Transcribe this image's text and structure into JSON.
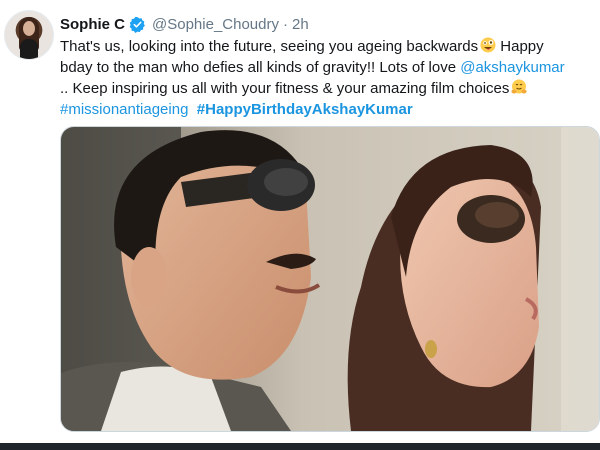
{
  "tweet": {
    "author_name": "Sophie C",
    "handle": "@Sophie_Choudry",
    "separator": "·",
    "time": "2h",
    "line1_text": "That's us, looking into the future, seeing you ageing backwards",
    "line1_tail": " Happy",
    "line2_text": "bday to the man who defies all kinds of gravity!! Lots of love ",
    "mention": "@akshaykumar",
    "line3_text": ".. Keep inspiring us all with your fitness & your amazing film choices",
    "hashtag1": "#missionantiageing",
    "hashtag2": "#HappyBirthdayAkshayKumar",
    "emoji1_icon": "winking-crazy-face-emoji",
    "emoji2_icon": "hugging-face-emoji"
  },
  "colors": {
    "link": "#1b95e0",
    "verified": "#1da1f2",
    "muted": "#657786",
    "text": "#14171a"
  }
}
